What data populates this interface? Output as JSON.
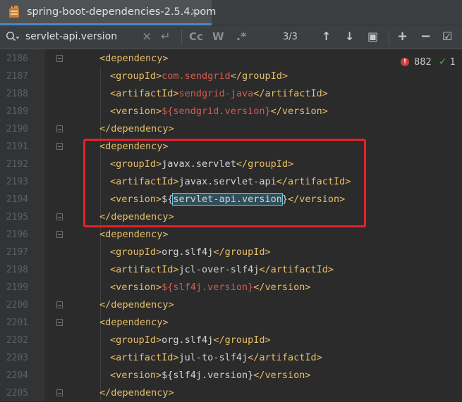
{
  "tab": {
    "title": "spring-boot-dependencies-2.5.4.pom",
    "close": "×",
    "icon": "maven-pom-file-icon"
  },
  "search": {
    "query": "servlet-api.version",
    "clear": "×",
    "replace_glyph": "↵",
    "match_case": "Cc",
    "whole_words": "W",
    "regex": ".*",
    "match_count": "3/3",
    "prev": "↑",
    "next": "↓",
    "filter": "▣",
    "add_selection": "+",
    "remove_selection": "−",
    "select_all": "☑"
  },
  "inspections": {
    "errors": "882",
    "weak_warnings": "1",
    "error_glyph": "!",
    "ok_glyph": "✓"
  },
  "editor": {
    "lines": [
      {
        "num": "2186",
        "indent": 1,
        "parts": [
          {
            "t": "<dependency>",
            "c": "tag"
          }
        ],
        "fold": true
      },
      {
        "num": "2187",
        "indent": 2,
        "parts": [
          {
            "t": "<groupId>",
            "c": "tag"
          },
          {
            "t": "com.sendgrid",
            "c": "red"
          },
          {
            "t": "</groupId>",
            "c": "tag"
          }
        ]
      },
      {
        "num": "2188",
        "indent": 2,
        "parts": [
          {
            "t": "<artifactId>",
            "c": "tag"
          },
          {
            "t": "sendgrid-java",
            "c": "red"
          },
          {
            "t": "</artifactId>",
            "c": "tag"
          }
        ]
      },
      {
        "num": "2189",
        "indent": 2,
        "parts": [
          {
            "t": "<version>",
            "c": "tag"
          },
          {
            "t": "${sendgrid.version}",
            "c": "red"
          },
          {
            "t": "</version>",
            "c": "tag"
          }
        ]
      },
      {
        "num": "2190",
        "indent": 1,
        "parts": [
          {
            "t": "</dependency>",
            "c": "tag"
          }
        ],
        "fold": true
      },
      {
        "num": "2191",
        "indent": 1,
        "parts": [
          {
            "t": "<dependency>",
            "c": "tag"
          }
        ],
        "fold": true
      },
      {
        "num": "2192",
        "indent": 2,
        "parts": [
          {
            "t": "<groupId>",
            "c": "tag"
          },
          {
            "t": "javax.servlet",
            "c": "plain"
          },
          {
            "t": "</groupId>",
            "c": "tag"
          }
        ]
      },
      {
        "num": "2193",
        "indent": 2,
        "parts": [
          {
            "t": "<artifactId>",
            "c": "tag"
          },
          {
            "t": "javax.servlet-api",
            "c": "plain"
          },
          {
            "t": "</artifactId>",
            "c": "tag"
          }
        ]
      },
      {
        "num": "2194",
        "indent": 2,
        "parts": [
          {
            "t": "<version>",
            "c": "tag"
          },
          {
            "t": "${",
            "c": "plain"
          },
          {
            "t": "servlet-api.version",
            "c": "hl"
          },
          {
            "t": "}",
            "c": "plain"
          },
          {
            "t": "</version>",
            "c": "tag"
          }
        ]
      },
      {
        "num": "2195",
        "indent": 1,
        "parts": [
          {
            "t": "</dependency>",
            "c": "tag"
          }
        ],
        "fold": true
      },
      {
        "num": "2196",
        "indent": 1,
        "parts": [
          {
            "t": "<dependency>",
            "c": "tag"
          }
        ],
        "fold": true
      },
      {
        "num": "2197",
        "indent": 2,
        "parts": [
          {
            "t": "<groupId>",
            "c": "tag"
          },
          {
            "t": "org.slf4j",
            "c": "plain"
          },
          {
            "t": "</groupId>",
            "c": "tag"
          }
        ]
      },
      {
        "num": "2198",
        "indent": 2,
        "parts": [
          {
            "t": "<artifactId>",
            "c": "tag"
          },
          {
            "t": "jcl-over-slf4j",
            "c": "plain"
          },
          {
            "t": "</artifactId>",
            "c": "tag"
          }
        ]
      },
      {
        "num": "2199",
        "indent": 2,
        "parts": [
          {
            "t": "<version>",
            "c": "tag"
          },
          {
            "t": "${slf4j.version}",
            "c": "red"
          },
          {
            "t": "</version>",
            "c": "tag"
          }
        ]
      },
      {
        "num": "2200",
        "indent": 1,
        "parts": [
          {
            "t": "</dependency>",
            "c": "tag"
          }
        ],
        "fold": true
      },
      {
        "num": "2201",
        "indent": 1,
        "parts": [
          {
            "t": "<dependency>",
            "c": "tag"
          }
        ],
        "fold": true
      },
      {
        "num": "2202",
        "indent": 2,
        "parts": [
          {
            "t": "<groupId>",
            "c": "tag"
          },
          {
            "t": "org.slf4j",
            "c": "plain"
          },
          {
            "t": "</groupId>",
            "c": "tag"
          }
        ]
      },
      {
        "num": "2203",
        "indent": 2,
        "parts": [
          {
            "t": "<artifactId>",
            "c": "tag"
          },
          {
            "t": "jul-to-slf4j",
            "c": "plain"
          },
          {
            "t": "</artifactId>",
            "c": "tag"
          }
        ]
      },
      {
        "num": "2204",
        "indent": 2,
        "parts": [
          {
            "t": "<version>",
            "c": "tag"
          },
          {
            "t": "${slf4j.version}",
            "c": "plain"
          },
          {
            "t": "</version>",
            "c": "tag"
          }
        ]
      },
      {
        "num": "2205",
        "indent": 1,
        "parts": [
          {
            "t": "</dependency>",
            "c": "tag"
          }
        ],
        "fold": true
      }
    ]
  },
  "colors": {
    "tag": "#e8bf6a",
    "error_text": "#d35b52",
    "annotation_box": "#e8202a",
    "match_outline": "#6ec5e0"
  }
}
